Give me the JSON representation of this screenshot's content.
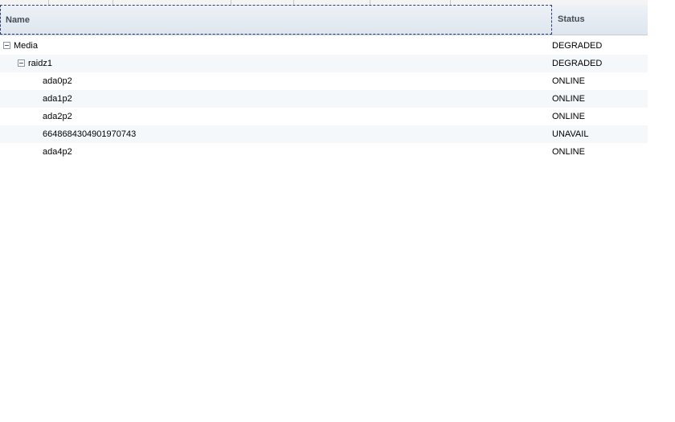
{
  "columns": {
    "name": "Name",
    "status": "Status"
  },
  "rows": [
    {
      "name": "Media",
      "status": "DEGRADED"
    },
    {
      "name": "raidz1",
      "status": "DEGRADED"
    },
    {
      "name": "ada0p2",
      "status": "ONLINE"
    },
    {
      "name": "ada1p2",
      "status": "ONLINE"
    },
    {
      "name": "ada2p2",
      "status": "ONLINE"
    },
    {
      "name": "6648684304901970743",
      "status": "UNAVAIL"
    },
    {
      "name": "ada4p2",
      "status": "ONLINE"
    }
  ]
}
